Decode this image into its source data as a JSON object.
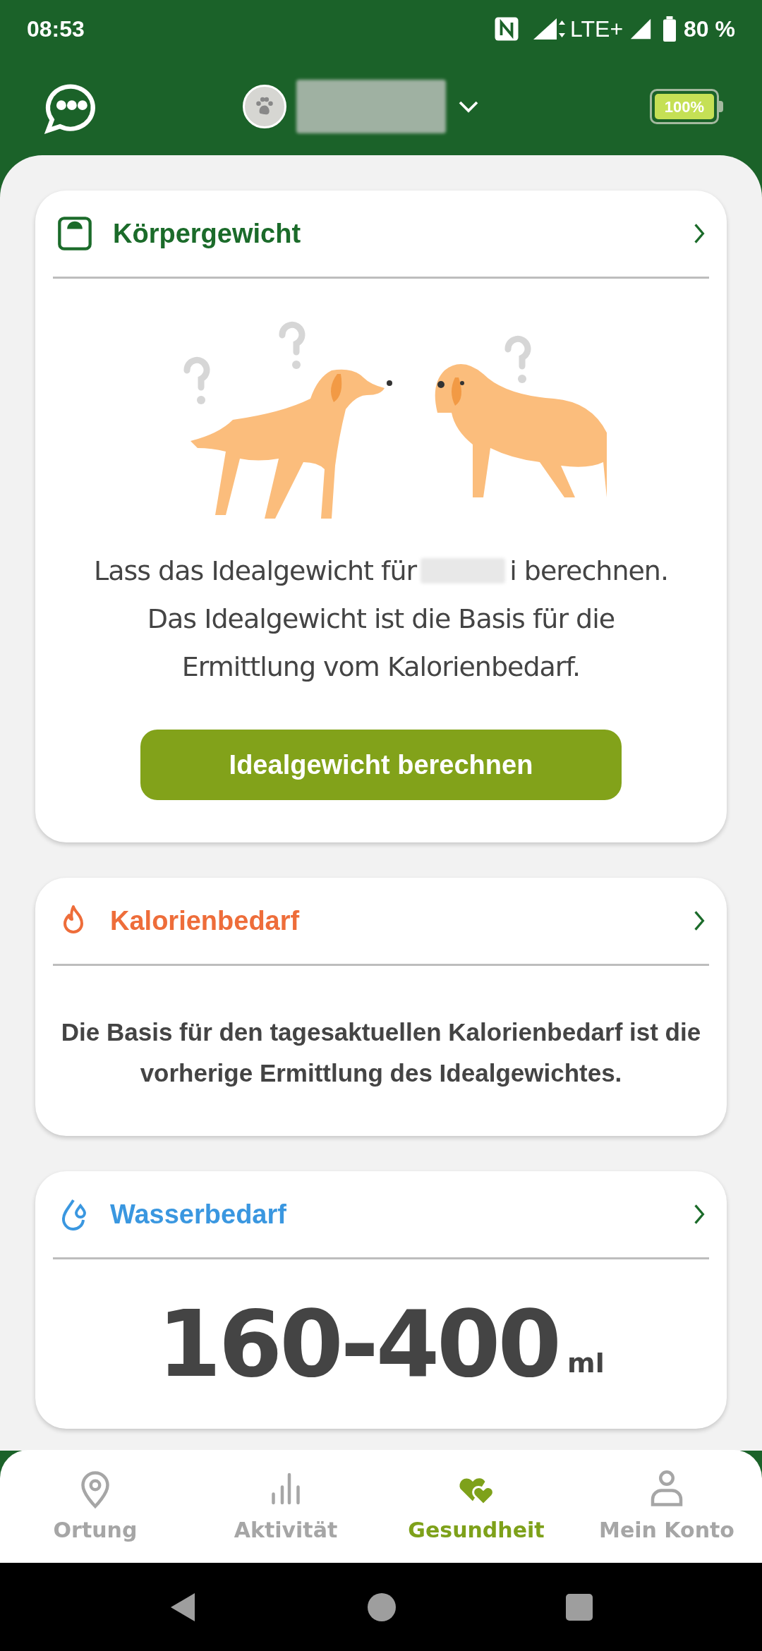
{
  "status_bar": {
    "time": "08:53",
    "network": "LTE+",
    "battery": "80 %"
  },
  "header": {
    "device_battery": "100%"
  },
  "cards": [
    {
      "kind": "weight",
      "title": "Körpergewicht",
      "color": "#1b6b2a",
      "text_lines": [
        "Lass das Idealgewicht für",
        "i berechnen.",
        "Das Idealgewicht ist die Basis für die",
        "Ermittlung vom Kalorienbedarf."
      ],
      "button": "Idealgewicht berechnen"
    },
    {
      "kind": "calories",
      "title": "Kalorienbedarf",
      "color": "#ee6d3a",
      "message": "Die Basis für den tagesaktuellen Kalorienbedarf ist die vorherige Ermittlung des Idealgewichtes."
    },
    {
      "kind": "water",
      "title": "Wasserbedarf",
      "color": "#3a97e0",
      "value": "160-400",
      "unit": "ml"
    }
  ],
  "nav": [
    {
      "kind": "location",
      "label": "Ortung",
      "selected": false
    },
    {
      "kind": "activity",
      "label": "Aktivität",
      "selected": false
    },
    {
      "kind": "health",
      "label": "Gesundheit",
      "selected": true
    },
    {
      "kind": "account",
      "label": "Mein Konto",
      "selected": false
    }
  ]
}
